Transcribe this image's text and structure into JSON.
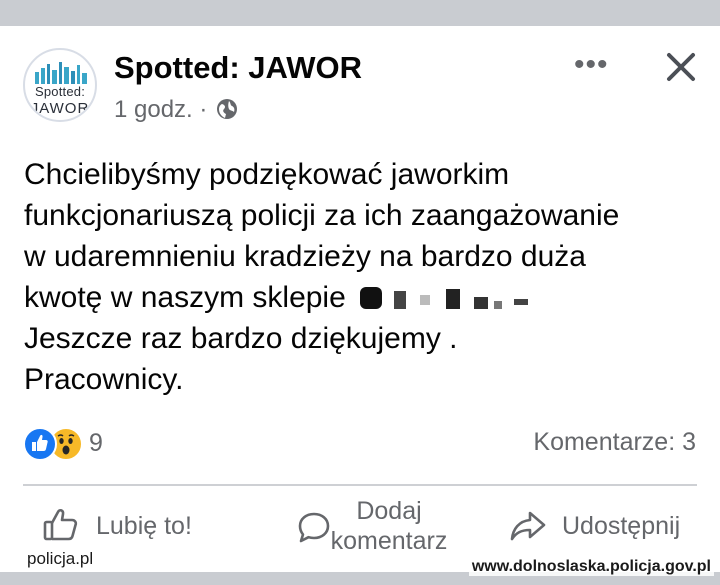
{
  "post": {
    "page_name": "Spotted: JAWOR",
    "time": "1 godz. ·",
    "avatar": {
      "line1": "Spotted:",
      "line2": "JAWOR"
    },
    "text_lines": [
      "Chcielibyśmy podziękować jaworkim",
      "funkcjonariuszą policji za ich zaangażowanie",
      "w udaremnieniu kradzieży na bardzo duża",
      "kwotę w naszym sklepie",
      "Jeszcze raz bardzo dziękujemy .",
      "Pracownicy."
    ]
  },
  "stats": {
    "reaction_count": "9",
    "comments": "Komentarze: 3",
    "reaction_icons": [
      "like-icon",
      "wow-icon"
    ]
  },
  "actions": {
    "like": "Lubię to!",
    "comment_line1": "Dodaj",
    "comment_line2": "komentarz",
    "share": "Udostępnij"
  },
  "watermarks": {
    "left": "policja.pl",
    "right": "www.dolnoslaska.policja.gov.pl"
  },
  "colors": {
    "like_blue": "#1877f2",
    "wow_yellow": "#f7b928",
    "secondary_text": "#65676b",
    "background": "#c9ccd1"
  }
}
